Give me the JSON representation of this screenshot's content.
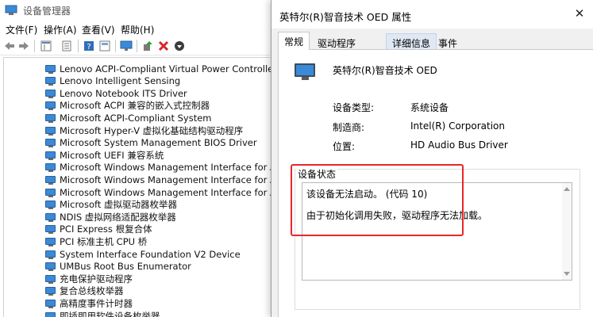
{
  "device_manager": {
    "title": "设备管理器",
    "menu": [
      "文件(F)",
      "操作(A)",
      "查看(V)",
      "帮助(H)"
    ],
    "toolbar_icons": [
      "back-arrow-icon",
      "forward-arrow-icon",
      "show-hide-tree-icon",
      "properties-icon",
      "help-icon",
      "monitor-scan-icon",
      "add-driver-icon",
      "uninstall-x-icon",
      "disable-down-icon"
    ],
    "tree_items": [
      "Lenovo ACPI-Compliant Virtual Power Controller",
      "Lenovo Intelligent Sensing",
      "Lenovo Notebook ITS Driver",
      "Microsoft ACPI 兼容的嵌入式控制器",
      "Microsoft ACPI-Compliant System",
      "Microsoft Hyper-V 虚拟化基础结构驱动程序",
      "Microsoft System Management BIOS Driver",
      "Microsoft UEFI 兼容系统",
      "Microsoft Windows Management Interface for ACPI",
      "Microsoft Windows Management Interface for ACPI",
      "Microsoft Windows Management Interface for ACPI",
      "Microsoft 虚拟驱动器枚举器",
      "NDIS 虚拟网络适配器枚举器",
      "PCI Express 根复合体",
      "PCI 标准主机 CPU 桥",
      "System Interface Foundation V2 Device",
      "UMBus Root Bus Enumerator",
      "充电保护驱动程序",
      "复合总线枚举器",
      "高精度事件计时器",
      "即插即用软件设备枚举器"
    ]
  },
  "dialog": {
    "title": "英特尔(R)智音技术 OED 属性",
    "close_glyph": "✕",
    "tabs": [
      "常规",
      "驱动程序",
      "详细信息",
      "事件"
    ],
    "device_name": "英特尔(R)智音技术 OED",
    "properties": [
      {
        "label": "设备类型:",
        "value": "系统设备"
      },
      {
        "label": "制造商:",
        "value": "Intel(R) Corporation"
      },
      {
        "label": "位置:",
        "value": "HD Audio Bus Driver"
      }
    ],
    "status_title": "设备状态",
    "status_line1": "该设备无法启动。 (代码 10)",
    "status_line2": "由于初始化调用失败，驱动程序无法加载。",
    "highlight_color": "#e8262a",
    "accent_color": "#f7d10a"
  }
}
